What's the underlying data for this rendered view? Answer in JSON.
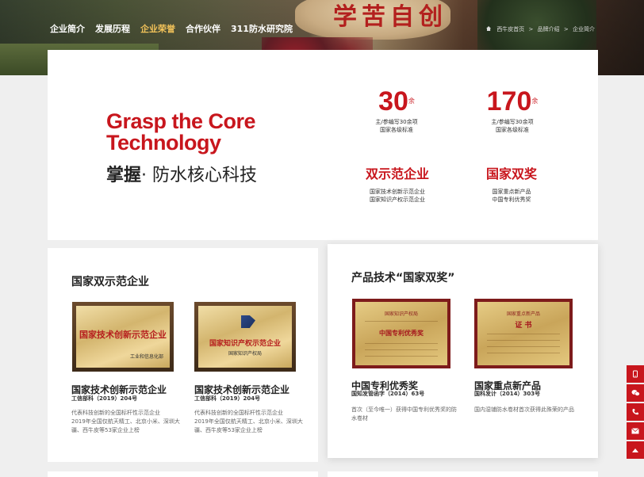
{
  "hero": {
    "calligraphy": "学苦自创"
  },
  "nav": {
    "items": [
      {
        "label": "企业简介"
      },
      {
        "label": "发展历程"
      },
      {
        "label": "企业荣誉",
        "active": true
      },
      {
        "label": "合作伙伴"
      },
      {
        "label": "311防水研究院"
      }
    ]
  },
  "breadcrumb": {
    "home": "西牛皮首页",
    "sep": ">",
    "level1": "品牌介绍",
    "level2": "企业简介"
  },
  "intro": {
    "title_en_line1": "Grasp the Core",
    "title_en_line2": "Technology",
    "title_cn_bold": "掌握",
    "title_cn_rest": "· 防水核心科技",
    "stats": [
      {
        "num": "30",
        "sup": "余",
        "desc1": "主/参编写30余项",
        "desc2": "国家各级标准"
      },
      {
        "num": "170",
        "sup": "余",
        "desc1": "主/参编写30余项",
        "desc2": "国家各级标准"
      }
    ],
    "honors": [
      {
        "word": "双示范企业",
        "desc1": "国家技术创新示范企业",
        "desc2": "国家知识产权示范企业"
      },
      {
        "word": "国家双奖",
        "desc1": "国家重点新产品",
        "desc2": "中国专利优秀奖"
      }
    ]
  },
  "left_card": {
    "title": "国家双示范企业",
    "items": [
      {
        "plaque_text": "国家技术创新示范企业",
        "plaque_sub": "工业和信息化部",
        "title": "国家技术创新示范企业",
        "sub": "工信部科（2019）204号",
        "desc1": "代表科技创新的全国标杆性示范企业",
        "desc2": "2019年全国仅航天精工、北京小米、深圳大",
        "desc3": "疆、西牛皮等53家企业上榜"
      },
      {
        "plaque_text": "国家知识产权示范企业",
        "plaque_sub": "国家知识产权局",
        "title": "国家技术创新示范企业",
        "sub": "工信部科（2019）204号",
        "desc1": "代表科技创新的全国标杆性示范企业",
        "desc2": "2019年全国仅航天精工、北京小米、深圳大",
        "desc3": "疆、西牛皮等53家企业上榜"
      }
    ]
  },
  "right_card": {
    "title": "产品技术“国家双奖”",
    "items": [
      {
        "cert_head": "国家知识产权局",
        "cert_title": "中国专利优秀奖",
        "title": "中国专利优秀奖",
        "sub": "国知发管函字（2014）63号",
        "desc1": "首次（至今唯一）获得中国专利优秀奖的防",
        "desc2": "水卷材"
      },
      {
        "cert_head": "国家重点新产品",
        "cert_title": "证 书",
        "title": "国家重点新产品",
        "sub": "国科发计（2014）303号",
        "desc1": "国内湿铺防水卷材首次获得此殊荣的产品",
        "desc2": ""
      }
    ]
  },
  "side_bar": {
    "icons": [
      "phone-icon",
      "wechat-icon",
      "call-icon",
      "mail-icon",
      "back-to-top-icon"
    ]
  },
  "colors": {
    "brand_red": "#c8161d",
    "nav_active": "#f3c35a"
  }
}
